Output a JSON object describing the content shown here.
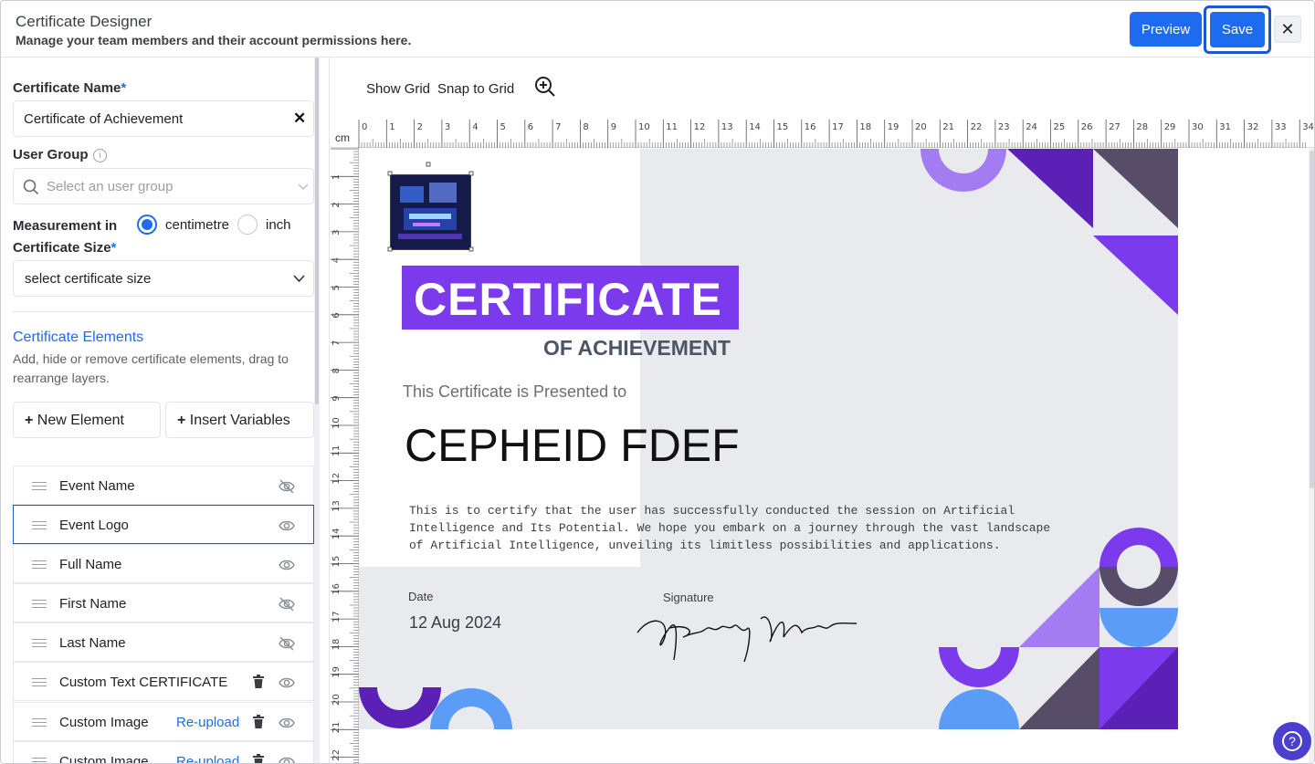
{
  "header": {
    "title": "Certificate Designer",
    "subtitle": "Manage your team members and their account permissions here.",
    "preview_label": "Preview",
    "save_label": "Save",
    "close_icon": "close-icon"
  },
  "form": {
    "name_label": "Certificate Name",
    "name_value": "Certificate of Achievement",
    "group_label": "User Group",
    "group_placeholder": "Select an user group",
    "measurement_label": "Measurement in",
    "unit_cm": "centimetre",
    "unit_inch": "inch",
    "selected_unit": "centimetre",
    "size_label": "Certificate Size",
    "size_value": "select certificate size",
    "required_mark": "*"
  },
  "elements_section": {
    "title": "Certificate Elements",
    "description": "Add, hide or remove certificate elements, drag to rearrange layers.",
    "new_element": "New Element",
    "insert_variables": "Insert Variables",
    "plus": "+",
    "items": [
      {
        "name": "Event Name",
        "visible": false,
        "deletable": false,
        "reupload": ""
      },
      {
        "name": "Event Logo",
        "visible": true,
        "deletable": false,
        "reupload": "",
        "selected": true
      },
      {
        "name": "Full Name",
        "visible": true,
        "deletable": false,
        "reupload": ""
      },
      {
        "name": "First Name",
        "visible": false,
        "deletable": false,
        "reupload": ""
      },
      {
        "name": "Last Name",
        "visible": false,
        "deletable": false,
        "reupload": ""
      },
      {
        "name": "Custom Text CERTIFICATE",
        "visible": true,
        "deletable": true,
        "reupload": ""
      },
      {
        "name": "Custom Image",
        "visible": true,
        "deletable": true,
        "reupload": "Re-upload"
      },
      {
        "name": "Custom Image",
        "visible": true,
        "deletable": true,
        "reupload": "Re-upload"
      }
    ]
  },
  "toolbar": {
    "show_grid": "Show Grid",
    "snap_to_grid": "Snap to Grid",
    "zoom_icon": "zoom-in-icon",
    "ruler_unit": "cm"
  },
  "certificate": {
    "title": "CERTIFICATE",
    "subtitle": "OF ACHIEVEMENT",
    "presented": "This Certificate is Presented to",
    "recipient": "CEPHEID FDEF",
    "body_lines": [
      "This is to certify that the user has successfully conducted the session on Artificial",
      "Intelligence and Its Potential. We hope you embark on a journey through the vast landscape",
      "of Artificial Intelligence, unveiling its limitless possibilities and applications."
    ],
    "date_label": "Date",
    "date_value": "12 Aug 2024",
    "signature_label": "Signature",
    "accent_color": "#7c3aed",
    "dark_color": "#5b21b6",
    "blue_color": "#5b9cf6",
    "slate_color": "#574d68"
  },
  "help": {
    "label": "?"
  }
}
